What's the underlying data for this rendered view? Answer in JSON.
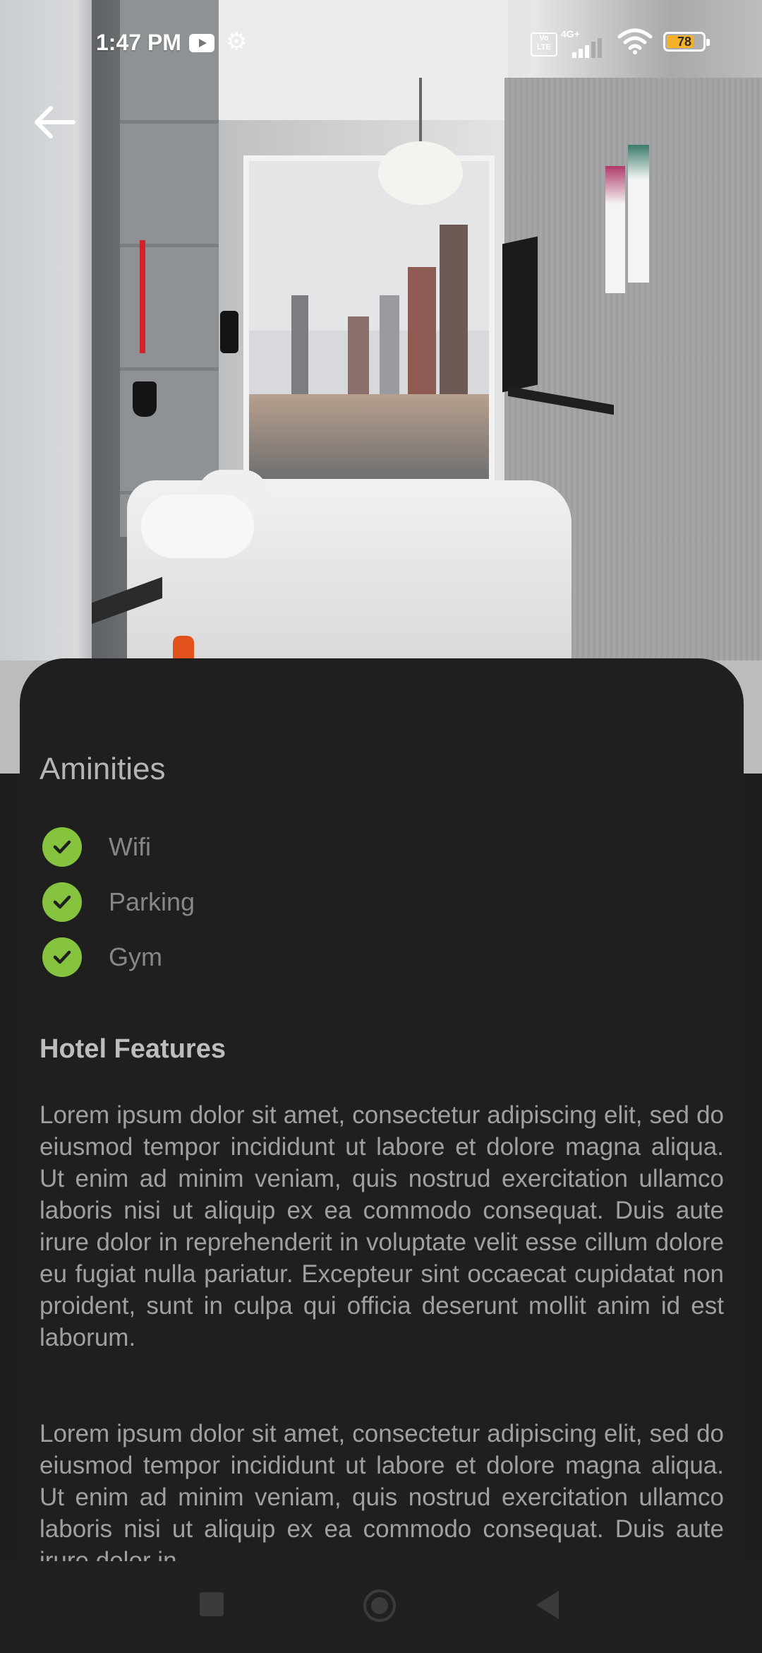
{
  "status_bar": {
    "time": "1:47 PM",
    "volte": "Vo LTE",
    "network": "4G+",
    "battery": "78",
    "battery_level": 0.78,
    "battery_color": "#f5b02a",
    "icons": [
      "youtube-icon",
      "gear-icon",
      "volte-icon",
      "signal-icon",
      "wifi-icon",
      "battery-icon"
    ]
  },
  "header": {
    "back_icon": "arrow-left-icon"
  },
  "amenities": {
    "title": "Aminities",
    "check_color": "#86c440",
    "items": [
      "Wifi",
      "Parking",
      "Gym"
    ]
  },
  "hotel_features": {
    "title": "Hotel Features",
    "paragraphs": [
      "Lorem ipsum dolor sit amet, consectetur adipiscing elit, sed do eiusmod tempor incididunt ut labore et dolore magna aliqua. Ut enim ad minim veniam, quis nostrud exercitation ullamco laboris nisi ut aliquip ex ea commodo consequat. Duis aute irure dolor in reprehenderit in voluptate velit esse cillum dolore eu fugiat nulla pariatur. Excepteur sint occaecat cupidatat non proident, sunt in culpa qui officia deserunt mollit anim id est laborum.",
      "Lorem ipsum dolor sit amet, consectetur adipiscing elit, sed do eiusmod tempor incididunt ut labore et dolore magna aliqua. Ut enim ad minim veniam, quis nostrud exercitation ullamco laboris nisi ut aliquip ex ea commodo consequat. Duis aute irure dolor in"
    ]
  },
  "nav_bar": {
    "icons": [
      "recents-square-icon",
      "home-circle-icon",
      "back-triangle-icon"
    ]
  }
}
